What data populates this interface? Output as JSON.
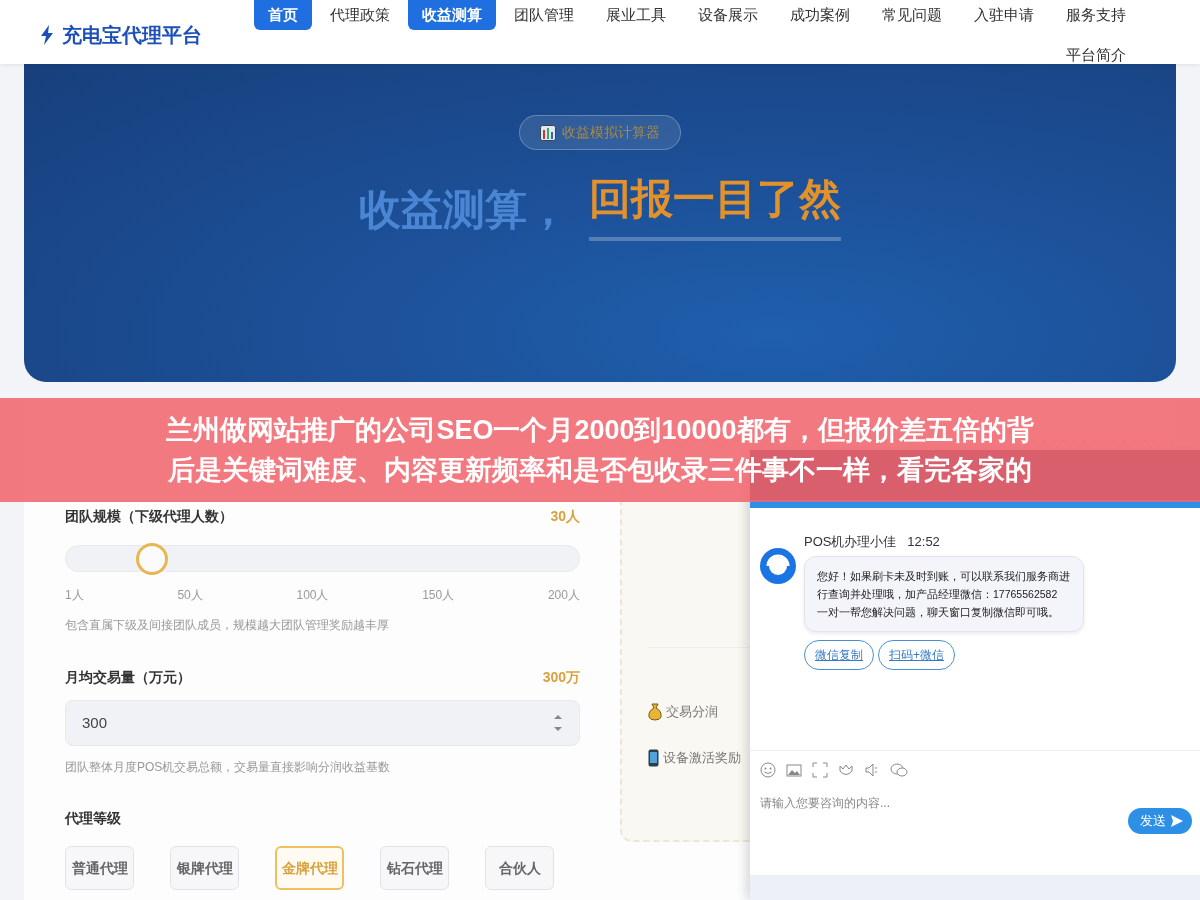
{
  "nav": {
    "logo": "充电宝代理平台",
    "items": [
      {
        "label": "首页",
        "selected": true
      },
      {
        "label": "代理政策",
        "selected": false
      },
      {
        "label": "收益测算",
        "selected": true
      },
      {
        "label": "团队管理",
        "selected": false
      },
      {
        "label": "展业工具",
        "selected": false
      },
      {
        "label": "设备展示",
        "selected": false
      },
      {
        "label": "成功案例",
        "selected": false
      },
      {
        "label": "常见问题",
        "selected": false
      },
      {
        "label": "入驻申请",
        "selected": false
      },
      {
        "label": "服务支持",
        "selected": false
      },
      {
        "label": "平台简介",
        "selected": false
      }
    ]
  },
  "hero": {
    "badge": "收益模拟计算器",
    "title": "收益测算，",
    "title_highlight": "回报一目了然"
  },
  "calculator": {
    "team": {
      "label": "团队规模（下级代理人数）",
      "value": "30人",
      "level": 0.146,
      "ticks": [
        "1人",
        "50人",
        "100人",
        "150人",
        "200人"
      ],
      "hint": "包含直属下级及间接团队成员，规模越大团队管理奖励越丰厚"
    },
    "volume": {
      "label": "月均交易量（万元）",
      "value": "300万",
      "input": "300",
      "hint": "团队整体月度POS机交易总额，交易量直接影响分润收益基数"
    },
    "grade": {
      "label": "代理等级",
      "options": [
        {
          "label": "普通代理",
          "selected": false
        },
        {
          "label": "银牌代理",
          "selected": false
        },
        {
          "label": "金牌代理",
          "selected": true
        },
        {
          "label": "钻石代理",
          "selected": false
        },
        {
          "label": "合伙人",
          "selected": false
        }
      ]
    }
  },
  "income_items": [
    {
      "kind": "bag",
      "label": "交易分润"
    },
    {
      "kind": "phone",
      "label": "设备激活奖励"
    }
  ],
  "banner": {
    "lines": [
      "兰州做网站推广的公司SEO一个月2000到10000都有，但报价差五倍的背",
      "后是关键词难度、内容更新频率和是否包收录三件事不一样，看完各家的"
    ]
  },
  "chat": {
    "agent": "POS机办理小佳",
    "time": "12:52",
    "message": "您好！如果刷卡未及时到账，可以联系我们服务商进行查询并处理哦，加产品经理微信：17765562582 一对一帮您解决问题，聊天窗口复制微信即可哦。",
    "actions": [
      "微信复制",
      "扫码+微信"
    ],
    "placeholder": "请输入您要咨询的内容...",
    "send": "发送"
  }
}
